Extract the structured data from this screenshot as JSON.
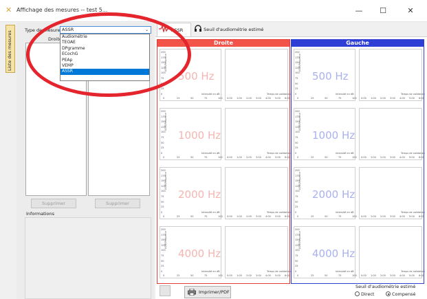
{
  "window": {
    "title": "Affichage des mesures -- test 5...",
    "minimize": "—",
    "maximize": "☐",
    "close": "✕"
  },
  "sidetab": {
    "label": "Liste des mesures"
  },
  "left": {
    "type_label": "Type de mesure",
    "droite_label": "Droite",
    "supprimer_left": "Supprimer",
    "supprimer_right": "Supprimer",
    "informations": "Informations"
  },
  "combo": {
    "selected": "ASSR",
    "options": [
      "Audiométrie",
      "TEOAE",
      "DPgramme",
      "ECochG",
      "PEAp",
      "VEMP",
      "ASSR"
    ]
  },
  "tabs": {
    "assr": "ASSR",
    "seuil": "Seuil d'audiométrie estimé"
  },
  "panels": {
    "droite": "Droite",
    "gauche": "Gauche",
    "freqs": [
      "500 Hz",
      "1000 Hz",
      "2000 Hz",
      "4000 Hz"
    ]
  },
  "chart_axes": {
    "left_yticks": [
      "200",
      "175",
      "150",
      "125",
      "100",
      "75",
      "50",
      "25",
      "0"
    ],
    "left_xticks": [
      "0",
      "25",
      "50",
      "75",
      "100"
    ],
    "right_xticks": [
      "0:00",
      "1:00",
      "2:00",
      "3:00",
      "4:00",
      "5:00",
      "6:00"
    ],
    "left_ylabel": "ASSR/Fréquence",
    "left_xlabel": "Intensité en dB",
    "right_xlabel": "Temps de validation"
  },
  "bottom": {
    "print": "Imprimer/PDF",
    "seuil_title": "Seuil d'audiométrie estimé",
    "direct": "Direct",
    "compense": "Compensé"
  },
  "colors": {
    "droite": "#e53935",
    "gauche": "#2f3fd6",
    "selection": "#0078d7"
  }
}
